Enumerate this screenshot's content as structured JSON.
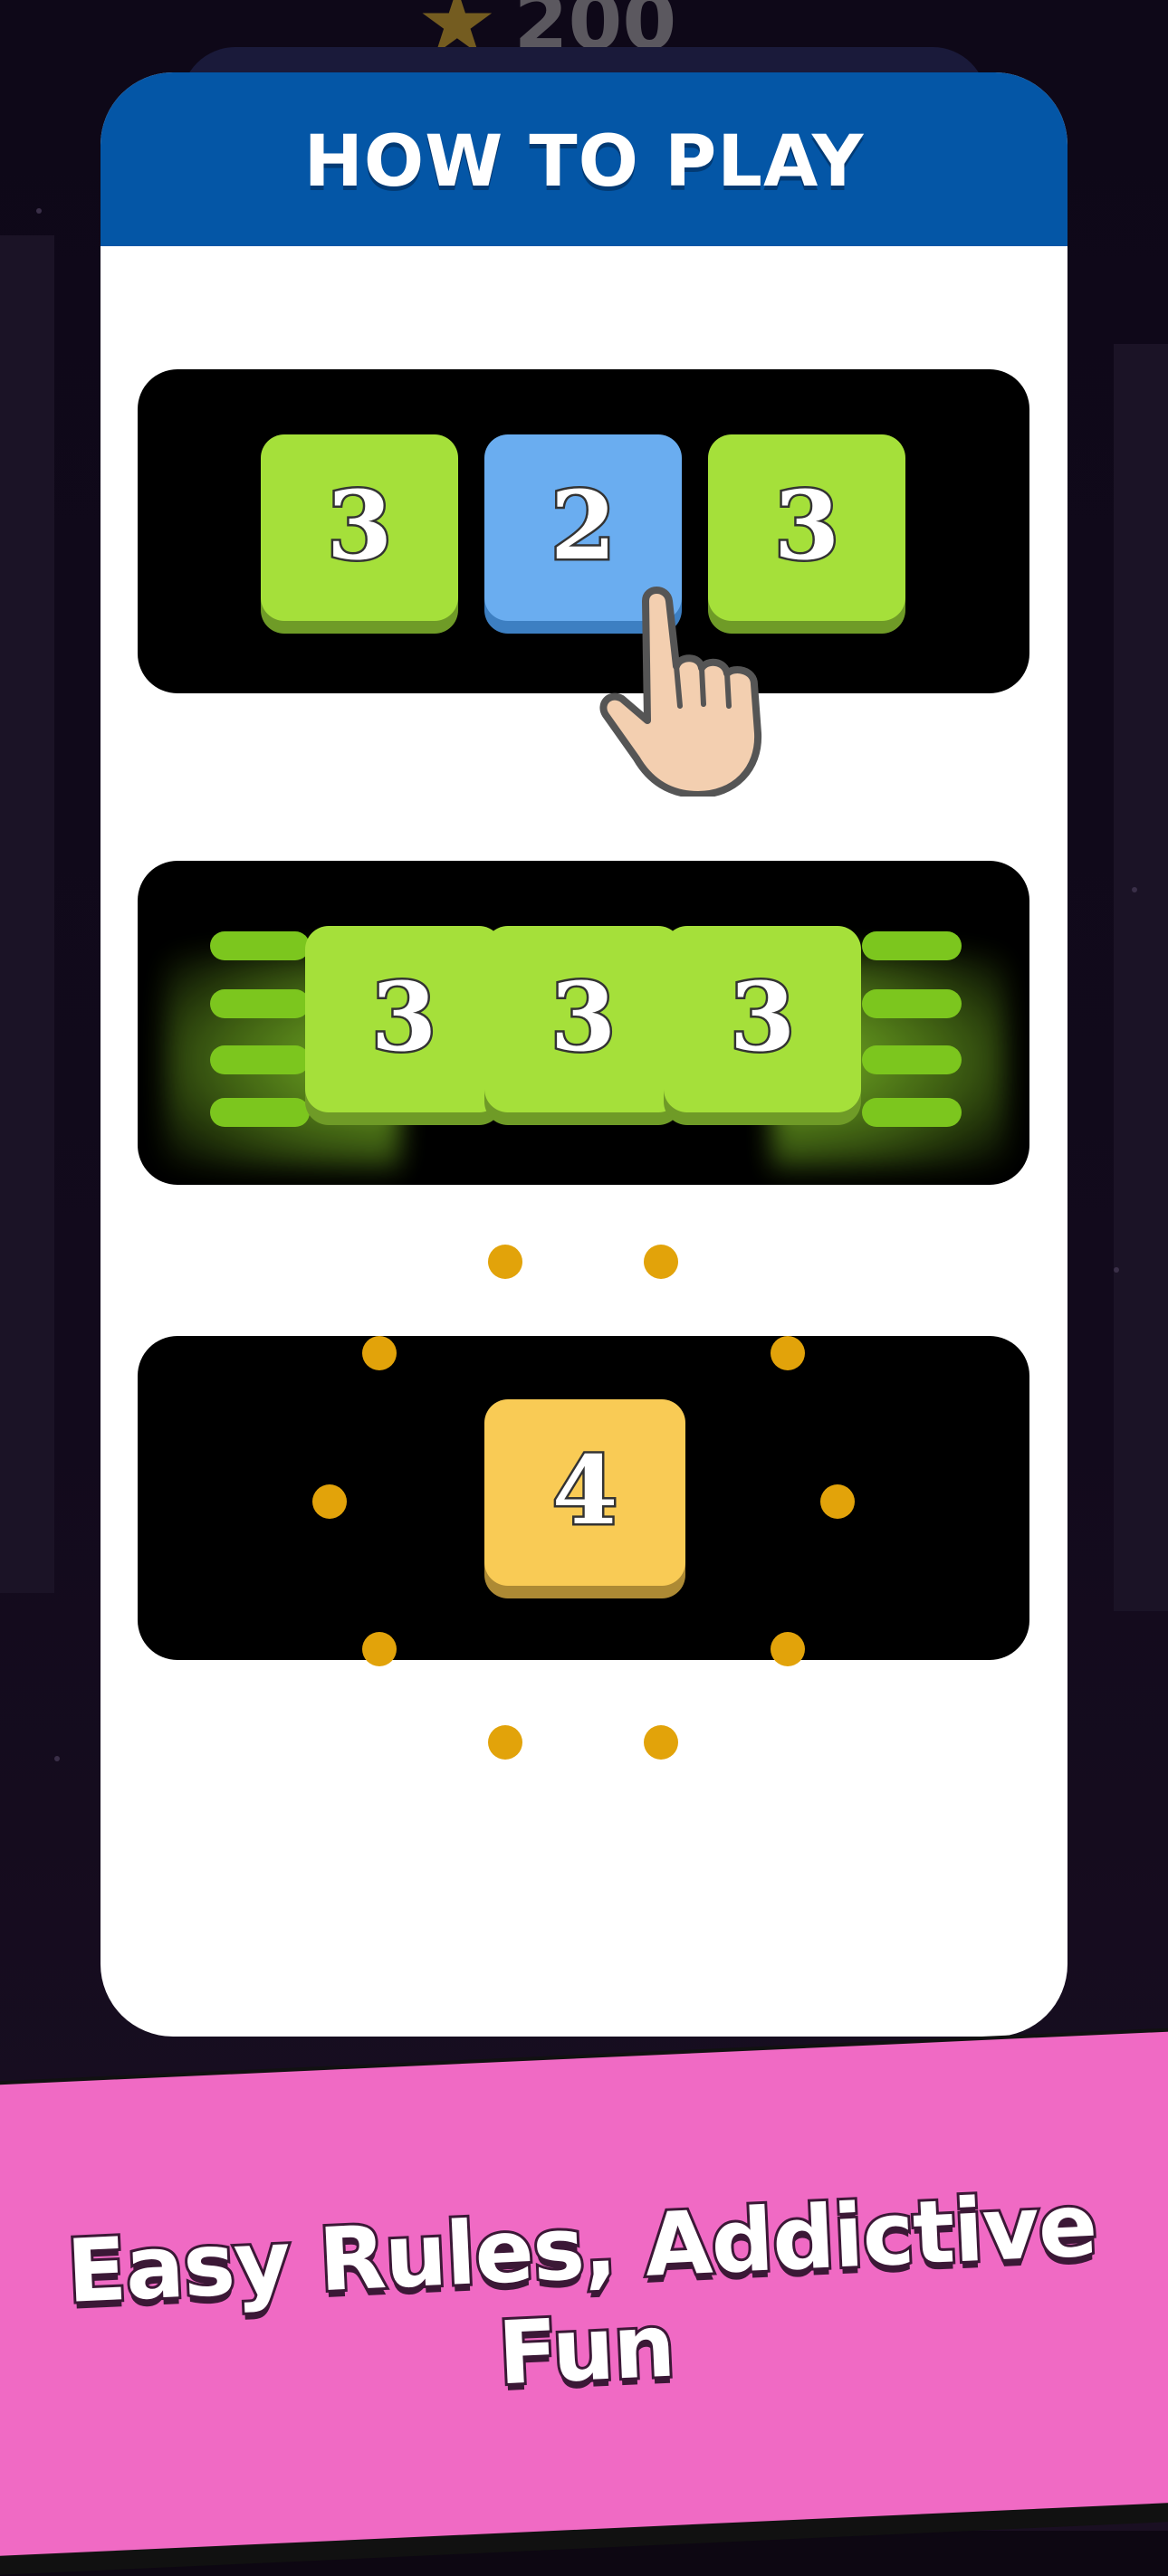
{
  "background": {
    "score_value": "200",
    "score_icon": "star-icon"
  },
  "panel": {
    "title": "HOW TO PLAY",
    "header_color": "#0456a6"
  },
  "step1": {
    "tiles": [
      "3",
      "2",
      "3"
    ],
    "tile_colors": [
      "#a5e03a",
      "#6aadf0",
      "#a5e03a"
    ],
    "pointer_icon": "pointing-hand-icon"
  },
  "step2": {
    "tiles": [
      "3",
      "3",
      "3"
    ],
    "tile_color": "#a5e03a"
  },
  "step3": {
    "tiles": [
      "4"
    ],
    "tile_color": "#f9cb55",
    "burst_icon": "burst-dots-icon"
  },
  "banner": {
    "text": "Easy Rules, Addictive Fun",
    "color": "#f06ac4"
  }
}
